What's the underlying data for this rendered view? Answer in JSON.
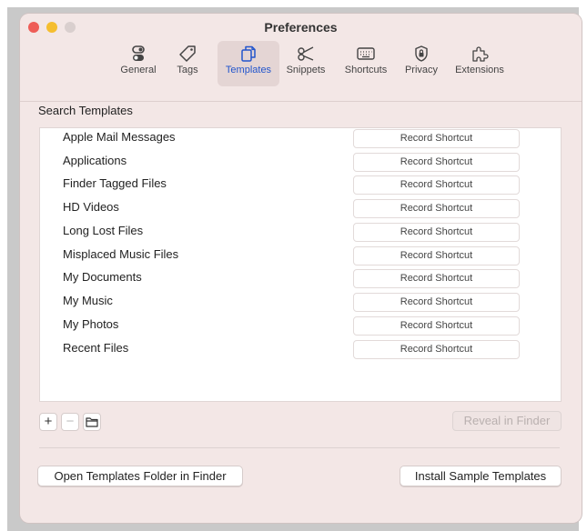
{
  "window": {
    "title": "Preferences"
  },
  "toolbar": {
    "items": [
      {
        "label": "General",
        "icon": "toggles-icon",
        "selected": false
      },
      {
        "label": "Tags",
        "icon": "tag-icon",
        "selected": false
      },
      {
        "label": "Templates",
        "icon": "templates-icon",
        "selected": true
      },
      {
        "label": "Snippets",
        "icon": "snippets-icon",
        "selected": false
      },
      {
        "label": "Shortcuts",
        "icon": "keyboard-icon",
        "selected": false
      },
      {
        "label": "Privacy",
        "icon": "privacy-lock-icon",
        "selected": false
      },
      {
        "label": "Extensions",
        "icon": "puzzle-icon",
        "selected": false
      }
    ],
    "selected_color": "#2255cc"
  },
  "search_templates": {
    "section_label": "Search Templates",
    "rows": [
      {
        "name": "Apple Mail Messages",
        "shortcut_label": "Record Shortcut"
      },
      {
        "name": "Applications",
        "shortcut_label": "Record Shortcut"
      },
      {
        "name": "Finder Tagged Files",
        "shortcut_label": "Record Shortcut"
      },
      {
        "name": "HD Videos",
        "shortcut_label": "Record Shortcut"
      },
      {
        "name": "Long Lost Files",
        "shortcut_label": "Record Shortcut"
      },
      {
        "name": "Misplaced Music Files",
        "shortcut_label": "Record Shortcut"
      },
      {
        "name": "My Documents",
        "shortcut_label": "Record Shortcut"
      },
      {
        "name": "My Music",
        "shortcut_label": "Record Shortcut"
      },
      {
        "name": "My Photos",
        "shortcut_label": "Record Shortcut"
      },
      {
        "name": "Recent Files",
        "shortcut_label": "Record Shortcut"
      }
    ]
  },
  "list_controls": {
    "add_label": "+",
    "remove_label": "−",
    "reveal_label": "Reveal in Finder"
  },
  "footer": {
    "open_folder_label": "Open Templates Folder in Finder",
    "install_samples_label": "Install Sample Templates"
  }
}
